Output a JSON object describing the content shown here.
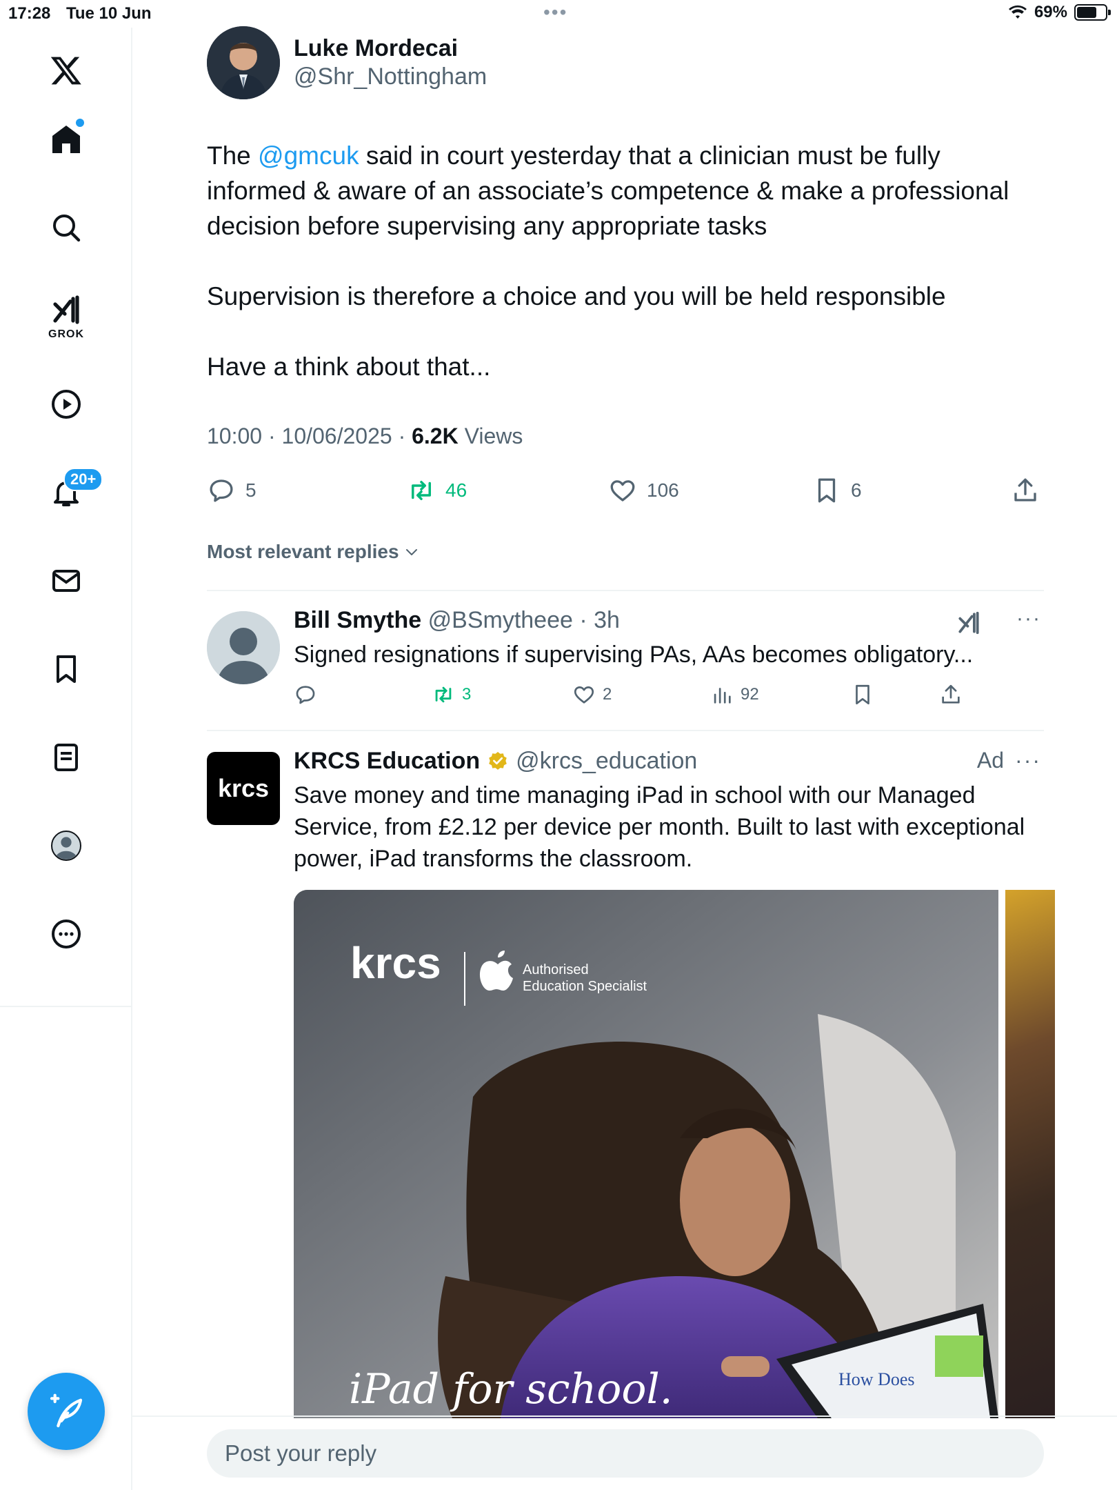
{
  "status_bar": {
    "time": "17:28",
    "date": "Tue 10 Jun",
    "battery": "69%",
    "battery_level": 0.69
  },
  "sidebar": {
    "items": [
      {
        "name": "x-logo"
      },
      {
        "name": "home",
        "has_dot": true
      },
      {
        "name": "search"
      },
      {
        "name": "grok",
        "label": "GROK"
      },
      {
        "name": "video"
      },
      {
        "name": "notifications",
        "badge": "20+"
      },
      {
        "name": "messages"
      },
      {
        "name": "bookmarks"
      },
      {
        "name": "lists"
      },
      {
        "name": "profile"
      },
      {
        "name": "more"
      }
    ]
  },
  "tweet": {
    "author_name": "Luke Mordecai",
    "author_handle": "@Shr_Nottingham",
    "text_prefix": "The ",
    "mention": "@gmcuk",
    "text_rest": " said in court yesterday that a clinician must be fully informed & aware of an associate’s competence & make a professional decision before supervising any appropriate tasks",
    "para2": "Supervision is therefore a choice and you will be held responsible",
    "para3": "Have a think about that...",
    "time": "10:00",
    "date": "10/06/2025",
    "views_count": "6.2K",
    "views_label": "Views",
    "replies": "5",
    "reposts": "46",
    "likes": "106",
    "bookmarks": "6"
  },
  "replies_filter": "Most relevant replies",
  "reply": {
    "name": "Bill Smythe",
    "handle": "@BSmytheee",
    "age": "3h",
    "text": "Signed resignations if supervising PAs, AAs becomes obligatory...",
    "reposts": "3",
    "likes": "2",
    "views": "92"
  },
  "ad": {
    "name": "KRCS Education",
    "handle": "@krcs_education",
    "ad_label": "Ad",
    "logo_text": "krcs",
    "text": "Save money and time managing iPad in school with our Managed Service, from £2.12 per device per month. Built to last with exceptional power, iPad transforms the classroom.",
    "media_brand": "krcs",
    "media_badge_line1": "Authorised",
    "media_badge_line2": "Education Specialist",
    "media_tagline": "iPad for school.",
    "screen_text": "How Does"
  },
  "reply_input": {
    "placeholder": "Post your reply"
  },
  "colors": {
    "accent": "#1d9bf0",
    "repost_green": "#00ba7c",
    "muted": "#536471"
  }
}
